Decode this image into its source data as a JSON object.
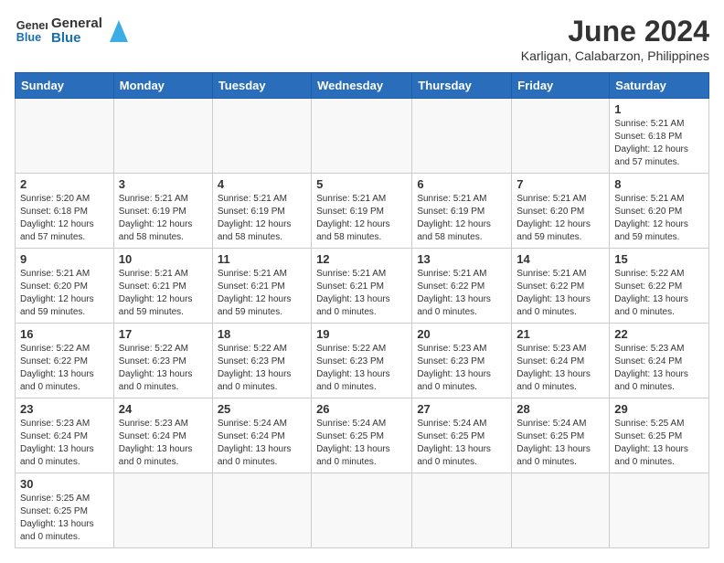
{
  "header": {
    "logo_general": "General",
    "logo_blue": "Blue",
    "title": "June 2024",
    "subtitle": "Karligan, Calabarzon, Philippines"
  },
  "weekdays": [
    "Sunday",
    "Monday",
    "Tuesday",
    "Wednesday",
    "Thursday",
    "Friday",
    "Saturday"
  ],
  "weeks": [
    [
      {
        "day": "",
        "empty": true
      },
      {
        "day": "",
        "empty": true
      },
      {
        "day": "",
        "empty": true
      },
      {
        "day": "",
        "empty": true
      },
      {
        "day": "",
        "empty": true
      },
      {
        "day": "",
        "empty": true
      },
      {
        "day": "1",
        "sunrise": "5:21 AM",
        "sunset": "6:18 PM",
        "daylight": "12 hours and 57 minutes."
      }
    ],
    [
      {
        "day": "2",
        "sunrise": "5:20 AM",
        "sunset": "6:18 PM",
        "daylight": "12 hours and 57 minutes."
      },
      {
        "day": "3",
        "sunrise": "5:21 AM",
        "sunset": "6:19 PM",
        "daylight": "12 hours and 58 minutes."
      },
      {
        "day": "4",
        "sunrise": "5:21 AM",
        "sunset": "6:19 PM",
        "daylight": "12 hours and 58 minutes."
      },
      {
        "day": "5",
        "sunrise": "5:21 AM",
        "sunset": "6:19 PM",
        "daylight": "12 hours and 58 minutes."
      },
      {
        "day": "6",
        "sunrise": "5:21 AM",
        "sunset": "6:19 PM",
        "daylight": "12 hours and 58 minutes."
      },
      {
        "day": "7",
        "sunrise": "5:21 AM",
        "sunset": "6:20 PM",
        "daylight": "12 hours and 59 minutes."
      },
      {
        "day": "8",
        "sunrise": "5:21 AM",
        "sunset": "6:20 PM",
        "daylight": "12 hours and 59 minutes."
      }
    ],
    [
      {
        "day": "9",
        "sunrise": "5:21 AM",
        "sunset": "6:20 PM",
        "daylight": "12 hours and 59 minutes."
      },
      {
        "day": "10",
        "sunrise": "5:21 AM",
        "sunset": "6:21 PM",
        "daylight": "12 hours and 59 minutes."
      },
      {
        "day": "11",
        "sunrise": "5:21 AM",
        "sunset": "6:21 PM",
        "daylight": "12 hours and 59 minutes."
      },
      {
        "day": "12",
        "sunrise": "5:21 AM",
        "sunset": "6:21 PM",
        "daylight": "13 hours and 0 minutes."
      },
      {
        "day": "13",
        "sunrise": "5:21 AM",
        "sunset": "6:22 PM",
        "daylight": "13 hours and 0 minutes."
      },
      {
        "day": "14",
        "sunrise": "5:21 AM",
        "sunset": "6:22 PM",
        "daylight": "13 hours and 0 minutes."
      },
      {
        "day": "15",
        "sunrise": "5:22 AM",
        "sunset": "6:22 PM",
        "daylight": "13 hours and 0 minutes."
      }
    ],
    [
      {
        "day": "16",
        "sunrise": "5:22 AM",
        "sunset": "6:22 PM",
        "daylight": "13 hours and 0 minutes."
      },
      {
        "day": "17",
        "sunrise": "5:22 AM",
        "sunset": "6:23 PM",
        "daylight": "13 hours and 0 minutes."
      },
      {
        "day": "18",
        "sunrise": "5:22 AM",
        "sunset": "6:23 PM",
        "daylight": "13 hours and 0 minutes."
      },
      {
        "day": "19",
        "sunrise": "5:22 AM",
        "sunset": "6:23 PM",
        "daylight": "13 hours and 0 minutes."
      },
      {
        "day": "20",
        "sunrise": "5:23 AM",
        "sunset": "6:23 PM",
        "daylight": "13 hours and 0 minutes."
      },
      {
        "day": "21",
        "sunrise": "5:23 AM",
        "sunset": "6:24 PM",
        "daylight": "13 hours and 0 minutes."
      },
      {
        "day": "22",
        "sunrise": "5:23 AM",
        "sunset": "6:24 PM",
        "daylight": "13 hours and 0 minutes."
      }
    ],
    [
      {
        "day": "23",
        "sunrise": "5:23 AM",
        "sunset": "6:24 PM",
        "daylight": "13 hours and 0 minutes."
      },
      {
        "day": "24",
        "sunrise": "5:23 AM",
        "sunset": "6:24 PM",
        "daylight": "13 hours and 0 minutes."
      },
      {
        "day": "25",
        "sunrise": "5:24 AM",
        "sunset": "6:24 PM",
        "daylight": "13 hours and 0 minutes."
      },
      {
        "day": "26",
        "sunrise": "5:24 AM",
        "sunset": "6:25 PM",
        "daylight": "13 hours and 0 minutes."
      },
      {
        "day": "27",
        "sunrise": "5:24 AM",
        "sunset": "6:25 PM",
        "daylight": "13 hours and 0 minutes."
      },
      {
        "day": "28",
        "sunrise": "5:24 AM",
        "sunset": "6:25 PM",
        "daylight": "13 hours and 0 minutes."
      },
      {
        "day": "29",
        "sunrise": "5:25 AM",
        "sunset": "6:25 PM",
        "daylight": "13 hours and 0 minutes."
      }
    ],
    [
      {
        "day": "30",
        "sunrise": "5:25 AM",
        "sunset": "6:25 PM",
        "daylight": "13 hours and 0 minutes."
      },
      {
        "day": "",
        "empty": true
      },
      {
        "day": "",
        "empty": true
      },
      {
        "day": "",
        "empty": true
      },
      {
        "day": "",
        "empty": true
      },
      {
        "day": "",
        "empty": true
      },
      {
        "day": "",
        "empty": true
      }
    ]
  ]
}
